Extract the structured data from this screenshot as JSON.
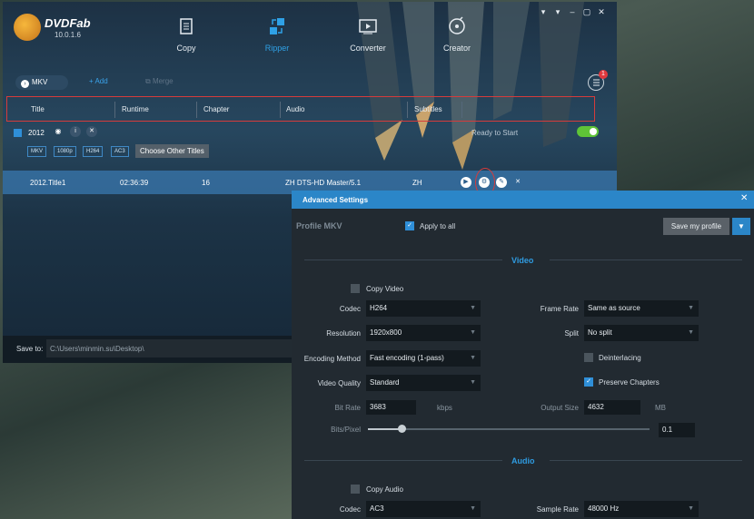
{
  "app": {
    "name": "DVDFab",
    "version": "10.0.1.6"
  },
  "window_controls": [
    "▾",
    "▾",
    "–",
    "▢",
    "✕"
  ],
  "modules": [
    {
      "label": "Copy",
      "icon": "copy-icon"
    },
    {
      "label": "Ripper",
      "icon": "ripper-icon"
    },
    {
      "label": "Converter",
      "icon": "converter-icon"
    },
    {
      "label": "Creator",
      "icon": "creator-icon"
    }
  ],
  "toolbar": {
    "format": "MKV",
    "add": "Add",
    "merge": "Merge",
    "notifications": "1"
  },
  "columns": [
    "Title",
    "Runtime",
    "Chapter",
    "Audio",
    "Subtitles"
  ],
  "source": {
    "name": "2012",
    "status": "Ready to Start",
    "tags": [
      "MKV",
      "1080p",
      "H264",
      "AC3"
    ],
    "choose_other": "Choose Other Titles"
  },
  "title_row": {
    "title": "2012.Title1",
    "runtime": "02:36:39",
    "chapter": "16",
    "audio": "ZH  DTS-HD Master/5.1",
    "subtitles": "ZH"
  },
  "save": {
    "label": "Save to:",
    "path": "C:\\Users\\minmin.su\\Desktop\\"
  },
  "advanced": {
    "title": "Advanced Settings",
    "profile": "Profile  MKV",
    "apply_all": "Apply to all",
    "save_profile": "Save my profile",
    "video_section": "Video",
    "copy_video": "Copy Video",
    "codec_label": "Codec",
    "codec": "H264",
    "resolution_label": "Resolution",
    "resolution": "1920x800",
    "encoding_label": "Encoding Method",
    "encoding": "Fast encoding (1-pass)",
    "quality_label": "Video Quality",
    "quality": "Standard",
    "bitrate_label": "Bit Rate",
    "bitrate": "3683",
    "bitrate_unit": "kbps",
    "bitspixel_label": "Bits/Pixel",
    "bitspixel": "0.1",
    "framerate_label": "Frame Rate",
    "framerate": "Same as source",
    "split_label": "Split",
    "split": "No split",
    "deinterlacing": "Deinterlacing",
    "preserve_chapters": "Preserve Chapters",
    "output_size_label": "Output Size",
    "output_size": "4632",
    "output_size_unit": "MB",
    "audio_section": "Audio",
    "copy_audio": "Copy Audio",
    "audio_codec_label": "Codec",
    "audio_codec": "AC3",
    "samplerate_label": "Sample Rate",
    "samplerate": "48000 Hz"
  },
  "colors": {
    "accent": "#2b86c8",
    "highlight": "#d63b3b",
    "toggle_on": "#5fc437"
  }
}
